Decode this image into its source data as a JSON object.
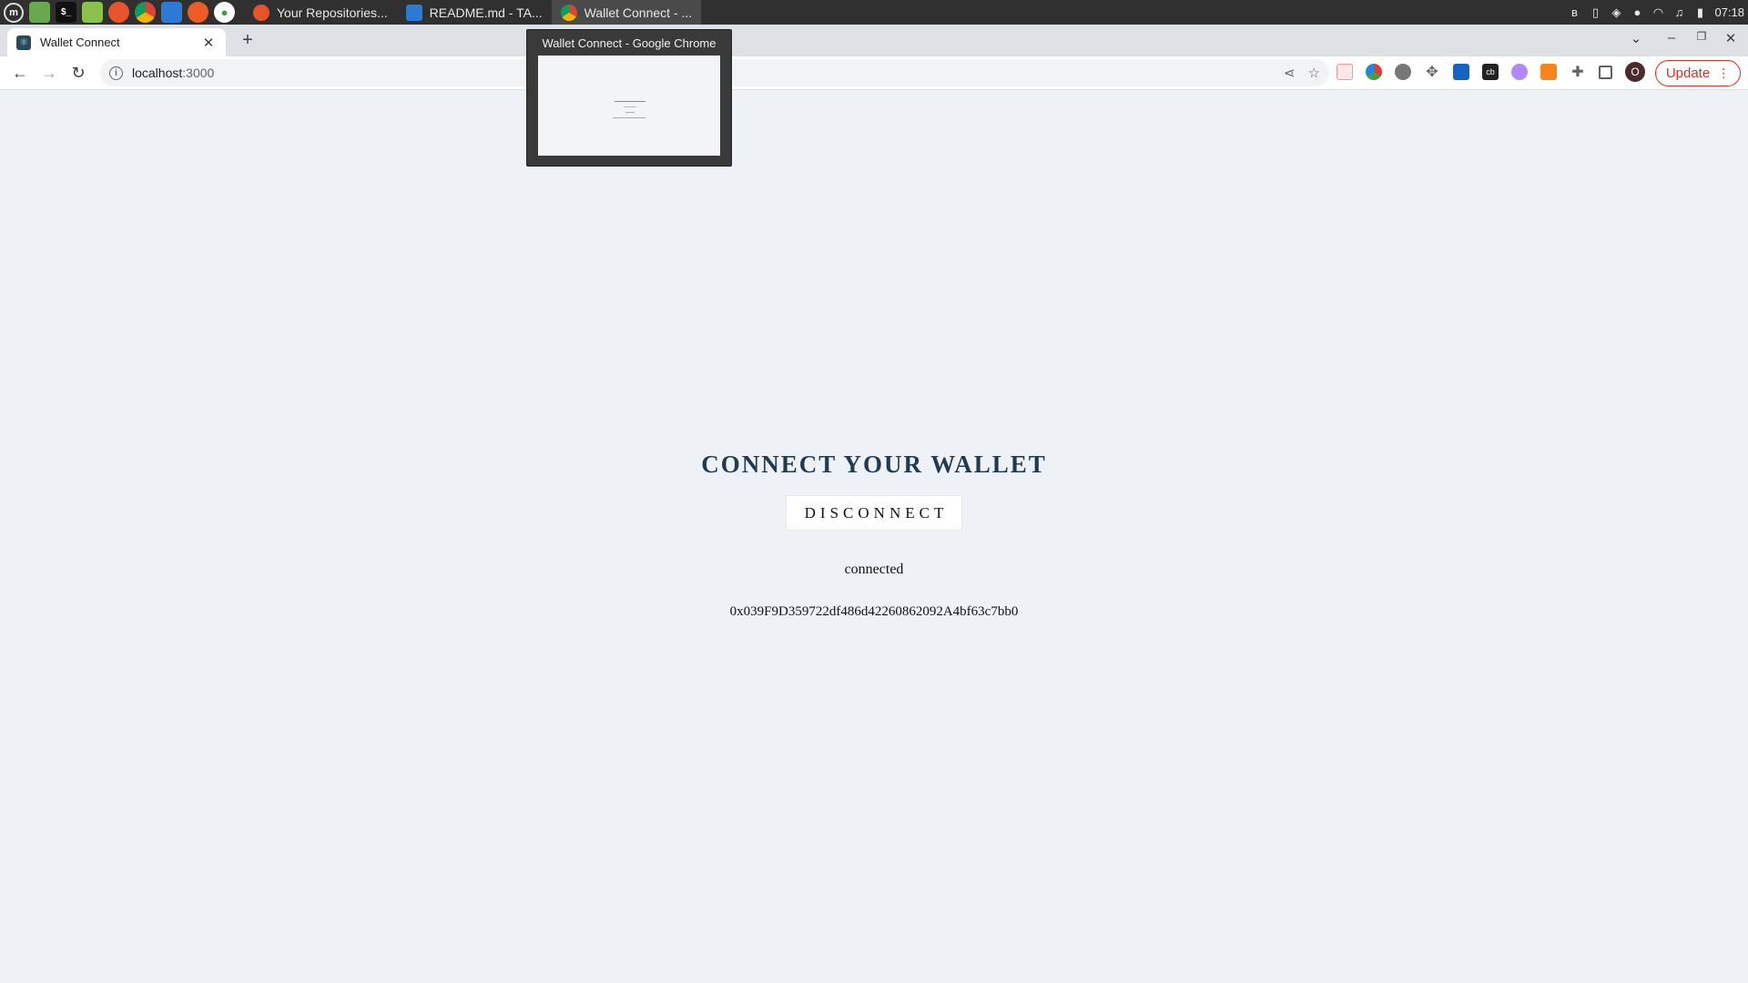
{
  "taskbar": {
    "windows": [
      {
        "label": "Your Repositories...",
        "icon": "firefox-icon",
        "color": "#e8542a"
      },
      {
        "label": "README.md - TA...",
        "icon": "vscode-icon",
        "color": "#2b7bd6"
      },
      {
        "label": "Wallet Connect - ...",
        "icon": "chrome-icon",
        "color": "#4caf50"
      }
    ],
    "clock": "07:18"
  },
  "browser": {
    "tab_title": "Wallet Connect",
    "url_host": "localhost",
    "url_port": ":3000",
    "update_label": "Update",
    "avatar_letter": "O"
  },
  "preview": {
    "title": "Wallet Connect - Google Chrome"
  },
  "page": {
    "heading": "CONNECT YOUR WALLET",
    "button_label": "DISCONNECT",
    "status": "connected",
    "address": "0x039F9D359722df486d42260862092A4bf63c7bb0"
  },
  "colors": {
    "page_bg": "#eef2f7",
    "heading": "#1f3a52",
    "update_accent": "#d93025"
  }
}
